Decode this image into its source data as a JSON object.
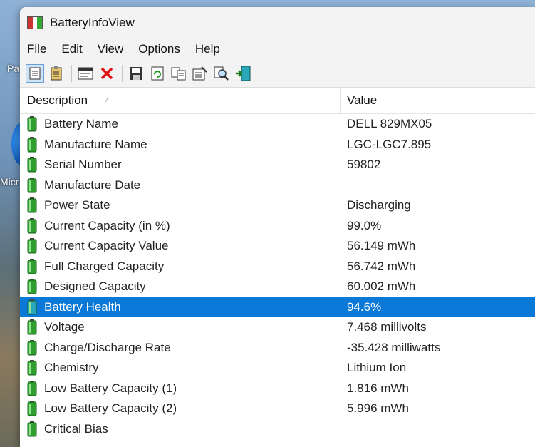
{
  "window": {
    "title": "BatteryInfoView"
  },
  "desktop": {
    "label_fragment_1": "Pa",
    "label_fragment_2": "Micr"
  },
  "menu": [
    "File",
    "Edit",
    "View",
    "Options",
    "Help"
  ],
  "toolbar_icons": [
    "html-report-icon",
    "properties-view-icon",
    "text-report-icon",
    "delete-icon",
    "save-icon",
    "refresh-icon",
    "copy-icon",
    "properties-icon",
    "find-icon",
    "exit-icon"
  ],
  "columns": {
    "description": "Description",
    "value": "Value"
  },
  "rows": [
    {
      "description": "Battery Name",
      "value": "DELL 829MX05"
    },
    {
      "description": "Manufacture Name",
      "value": "LGC-LGC7.895"
    },
    {
      "description": "Serial Number",
      "value": "59802"
    },
    {
      "description": "Manufacture Date",
      "value": ""
    },
    {
      "description": "Power State",
      "value": "Discharging"
    },
    {
      "description": "Current Capacity (in %)",
      "value": "99.0%"
    },
    {
      "description": "Current Capacity Value",
      "value": "56.149 mWh"
    },
    {
      "description": "Full Charged Capacity",
      "value": "56.742 mWh"
    },
    {
      "description": "Designed Capacity",
      "value": "60.002 mWh"
    },
    {
      "description": "Battery Health",
      "value": "94.6%",
      "selected": true
    },
    {
      "description": "Voltage",
      "value": "7.468 millivolts"
    },
    {
      "description": "Charge/Discharge Rate",
      "value": "-35.428 milliwatts"
    },
    {
      "description": "Chemistry",
      "value": "Lithium Ion"
    },
    {
      "description": "Low Battery Capacity (1)",
      "value": "1.816 mWh"
    },
    {
      "description": "Low Battery Capacity (2)",
      "value": "5.996 mWh"
    },
    {
      "description": "Critical Bias",
      "value": ""
    }
  ],
  "colors": {
    "selection": "#0a78d7",
    "battery_green": "#2e9e2e"
  }
}
